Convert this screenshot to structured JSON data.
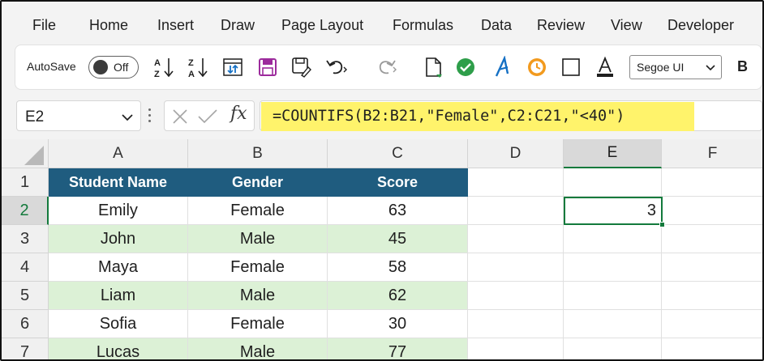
{
  "menu": [
    "File",
    "Home",
    "Insert",
    "Draw",
    "Page Layout",
    "Formulas",
    "Data",
    "Review",
    "View",
    "Developer"
  ],
  "ribbon": {
    "autosave_label": "AutoSave",
    "autosave_state": "Off",
    "font_name": "Segoe UI",
    "bold_label": "B",
    "icons": [
      "sort-ascending-icon",
      "sort-descending-icon",
      "refresh-data-icon",
      "save-icon",
      "save-as-icon",
      "undo-icon",
      "redo-icon",
      "new-document-icon",
      "checkmark-circle-icon",
      "text-effects-icon",
      "clock-icon",
      "border-icon",
      "font-color-icon"
    ],
    "colors": {
      "save": "#9c2b9c",
      "check": "#2e9e4a",
      "text_effect": "#1570c4",
      "clock": "#f29a1e",
      "font_color_bar": "#1f1f1f"
    }
  },
  "formula_bar": {
    "name_box": "E2",
    "fx_label": "fx",
    "formula": "=COUNTIFS(B2:B21,\"Female\",C2:C21,\"<40\")",
    "highlight_color": "#fff36b"
  },
  "columns": [
    "A",
    "B",
    "C",
    "D",
    "E",
    "F"
  ],
  "rows": [
    "1",
    "2",
    "3",
    "4",
    "5",
    "6",
    "7"
  ],
  "selected": {
    "column": "E",
    "row": "2"
  },
  "table": {
    "headers": [
      "Student Name",
      "Gender",
      "Score"
    ],
    "data": [
      [
        "Emily",
        "Female",
        "63"
      ],
      [
        "John",
        "Male",
        "45"
      ],
      [
        "Maya",
        "Female",
        "58"
      ],
      [
        "Liam",
        "Male",
        "62"
      ],
      [
        "Sofia",
        "Female",
        "30"
      ],
      [
        "Lucas",
        "Male",
        "77"
      ]
    ],
    "header_color": "#1f5c7f",
    "band_color": "#dcf1d6"
  },
  "result": {
    "cell": "E2",
    "value": "3"
  }
}
